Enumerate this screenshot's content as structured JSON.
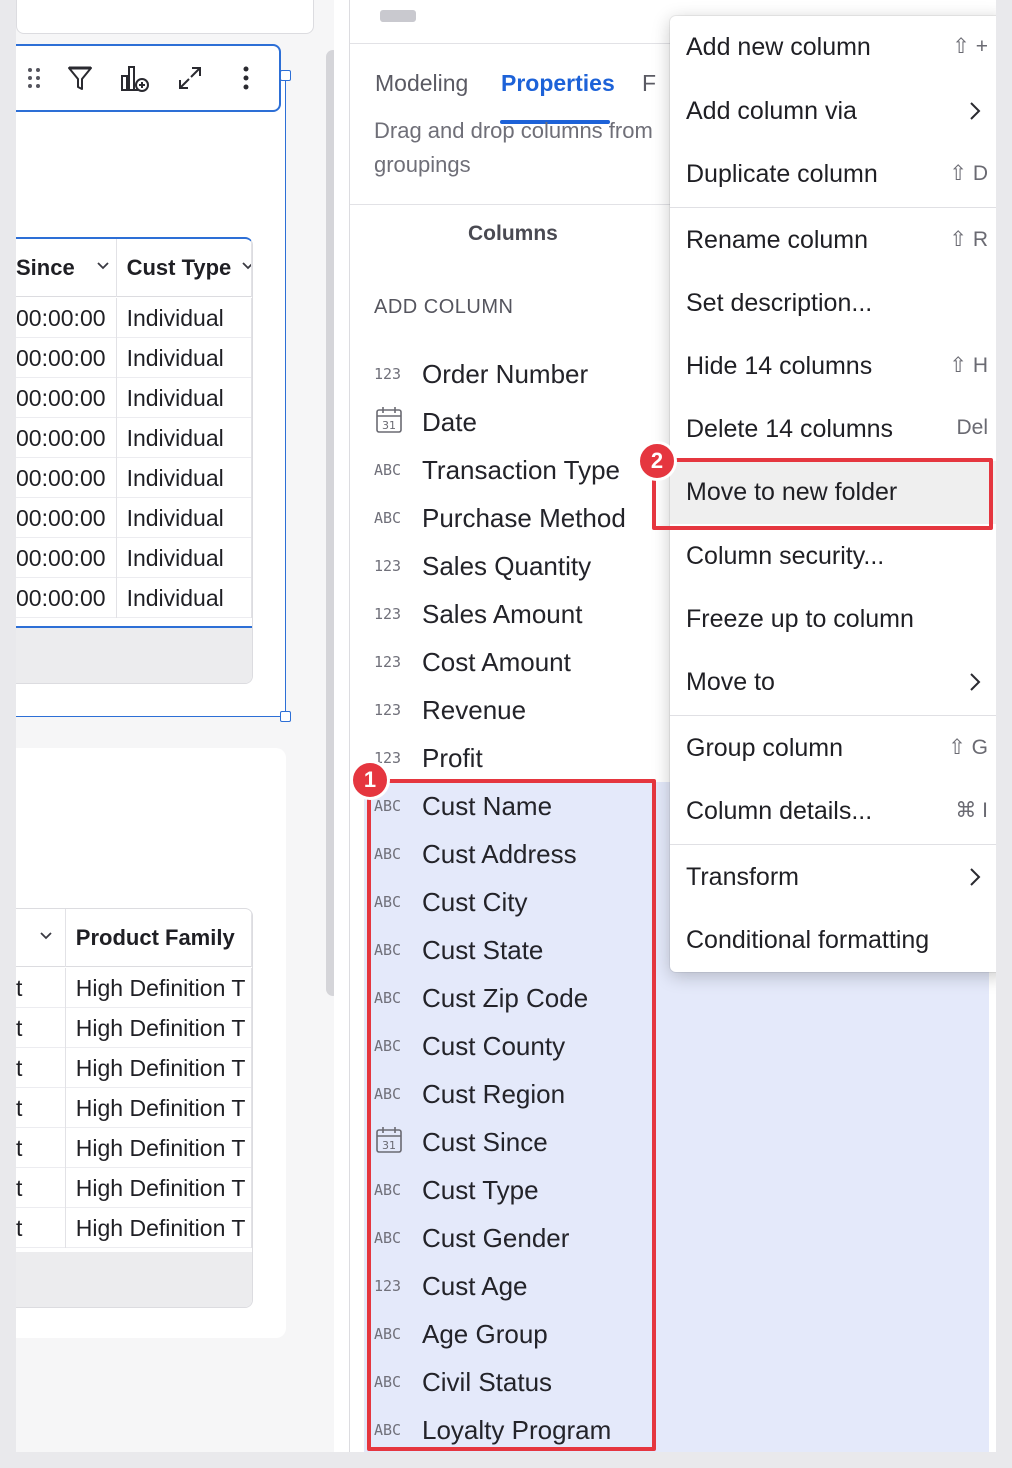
{
  "canvas": {
    "table1": {
      "headers": [
        "Since",
        "Cust Type"
      ],
      "rows": [
        [
          "00:00:00",
          "Individual"
        ],
        [
          "00:00:00",
          "Individual"
        ],
        [
          "00:00:00",
          "Individual"
        ],
        [
          "00:00:00",
          "Individual"
        ],
        [
          "00:00:00",
          "Individual"
        ],
        [
          "00:00:00",
          "Individual"
        ],
        [
          "00:00:00",
          "Individual"
        ],
        [
          "00:00:00",
          "Individual"
        ]
      ]
    },
    "table2": {
      "headers": [
        "",
        "Product Family"
      ],
      "rows": [
        [
          "t",
          "High Definition T"
        ],
        [
          "t",
          "High Definition T"
        ],
        [
          "t",
          "High Definition T"
        ],
        [
          "t",
          "High Definition T"
        ],
        [
          "t",
          "High Definition T"
        ],
        [
          "t",
          "High Definition T"
        ],
        [
          "t",
          "High Definition T"
        ]
      ]
    }
  },
  "panel": {
    "tabs": [
      "Modeling",
      "Properties",
      "F"
    ],
    "hint": "Drag and drop columns from groupings",
    "columns_title": "Columns",
    "add_column": "ADD COLUMN",
    "columns": [
      {
        "type": "123",
        "label": "Order Number"
      },
      {
        "type": "date",
        "label": "Date"
      },
      {
        "type": "ABC",
        "label": "Transaction Type"
      },
      {
        "type": "ABC",
        "label": "Purchase Method"
      },
      {
        "type": "123",
        "label": "Sales Quantity"
      },
      {
        "type": "123",
        "label": "Sales Amount"
      },
      {
        "type": "123",
        "label": "Cost Amount"
      },
      {
        "type": "123",
        "label": "Revenue"
      },
      {
        "type": "123",
        "label": "Profit"
      },
      {
        "type": "ABC",
        "label": "Cust Name"
      },
      {
        "type": "ABC",
        "label": "Cust Address"
      },
      {
        "type": "ABC",
        "label": "Cust City"
      },
      {
        "type": "ABC",
        "label": "Cust State"
      },
      {
        "type": "ABC",
        "label": "Cust Zip Code"
      },
      {
        "type": "ABC",
        "label": "Cust County"
      },
      {
        "type": "ABC",
        "label": "Cust Region"
      },
      {
        "type": "date",
        "label": "Cust Since"
      },
      {
        "type": "ABC",
        "label": "Cust Type"
      },
      {
        "type": "ABC",
        "label": "Cust Gender"
      },
      {
        "type": "123",
        "label": "Cust Age"
      },
      {
        "type": "ABC",
        "label": "Age Group"
      },
      {
        "type": "ABC",
        "label": "Civil Status"
      },
      {
        "type": "ABC",
        "label": "Loyalty Program"
      }
    ],
    "date_icon_text": "31"
  },
  "menu": {
    "items": [
      {
        "label": "Add new column",
        "shortcut": "⇧ +"
      },
      {
        "label": "Add column via",
        "submenu": true
      },
      {
        "label": "Duplicate column",
        "shortcut": "⇧ D"
      },
      {
        "label": "Rename column",
        "shortcut": "⇧ R"
      },
      {
        "label": "Set description...",
        "shortcut": ""
      },
      {
        "label": "Hide 14 columns",
        "shortcut": "⇧ H"
      },
      {
        "label": "Delete 14 columns",
        "shortcut": "Del"
      },
      {
        "label": "Move to new folder",
        "shortcut": ""
      },
      {
        "label": "Column security...",
        "shortcut": ""
      },
      {
        "label": "Freeze up to column",
        "shortcut": ""
      },
      {
        "label": "Move to",
        "submenu": true
      },
      {
        "label": "Group column",
        "shortcut": "⇧ G"
      },
      {
        "label": "Column details...",
        "shortcut": "⌘ I"
      },
      {
        "label": "Transform",
        "submenu": true
      },
      {
        "label": "Conditional formatting",
        "shortcut": ""
      }
    ]
  },
  "annotations": {
    "badge_1": "1",
    "badge_2": "2",
    "accent_color": "#e5363f",
    "selection_color": "#2d6fd6"
  }
}
